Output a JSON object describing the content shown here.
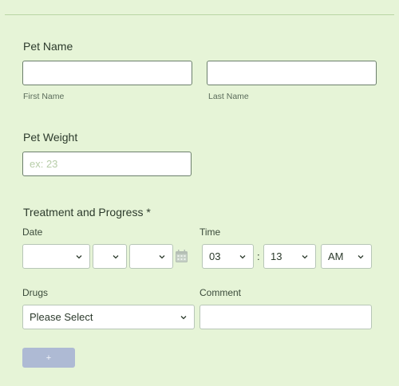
{
  "pet_name": {
    "label": "Pet Name",
    "first_name_label": "First Name",
    "last_name_label": "Last Name",
    "first_name_value": "",
    "last_name_value": ""
  },
  "pet_weight": {
    "label": "Pet Weight",
    "placeholder": "ex: 23",
    "value": ""
  },
  "treatment": {
    "title": "Treatment and Progress *",
    "date_label": "Date",
    "time_label": "Time",
    "date_month": "",
    "date_day": "",
    "date_year": "",
    "hour": "03",
    "minute": "13",
    "separator": ":",
    "ampm": "AM",
    "drugs_label": "Drugs",
    "drugs_value": "Please Select",
    "comment_label": "Comment",
    "comment_value": "",
    "add_button": "+"
  },
  "icons": [
    "chevron-down-icon",
    "calendar-icon"
  ],
  "colors": {
    "background": "#e6f4d7",
    "input_border": "#6b7f6b",
    "add_button": "#aebad4",
    "placeholder": "#b7cda8"
  }
}
